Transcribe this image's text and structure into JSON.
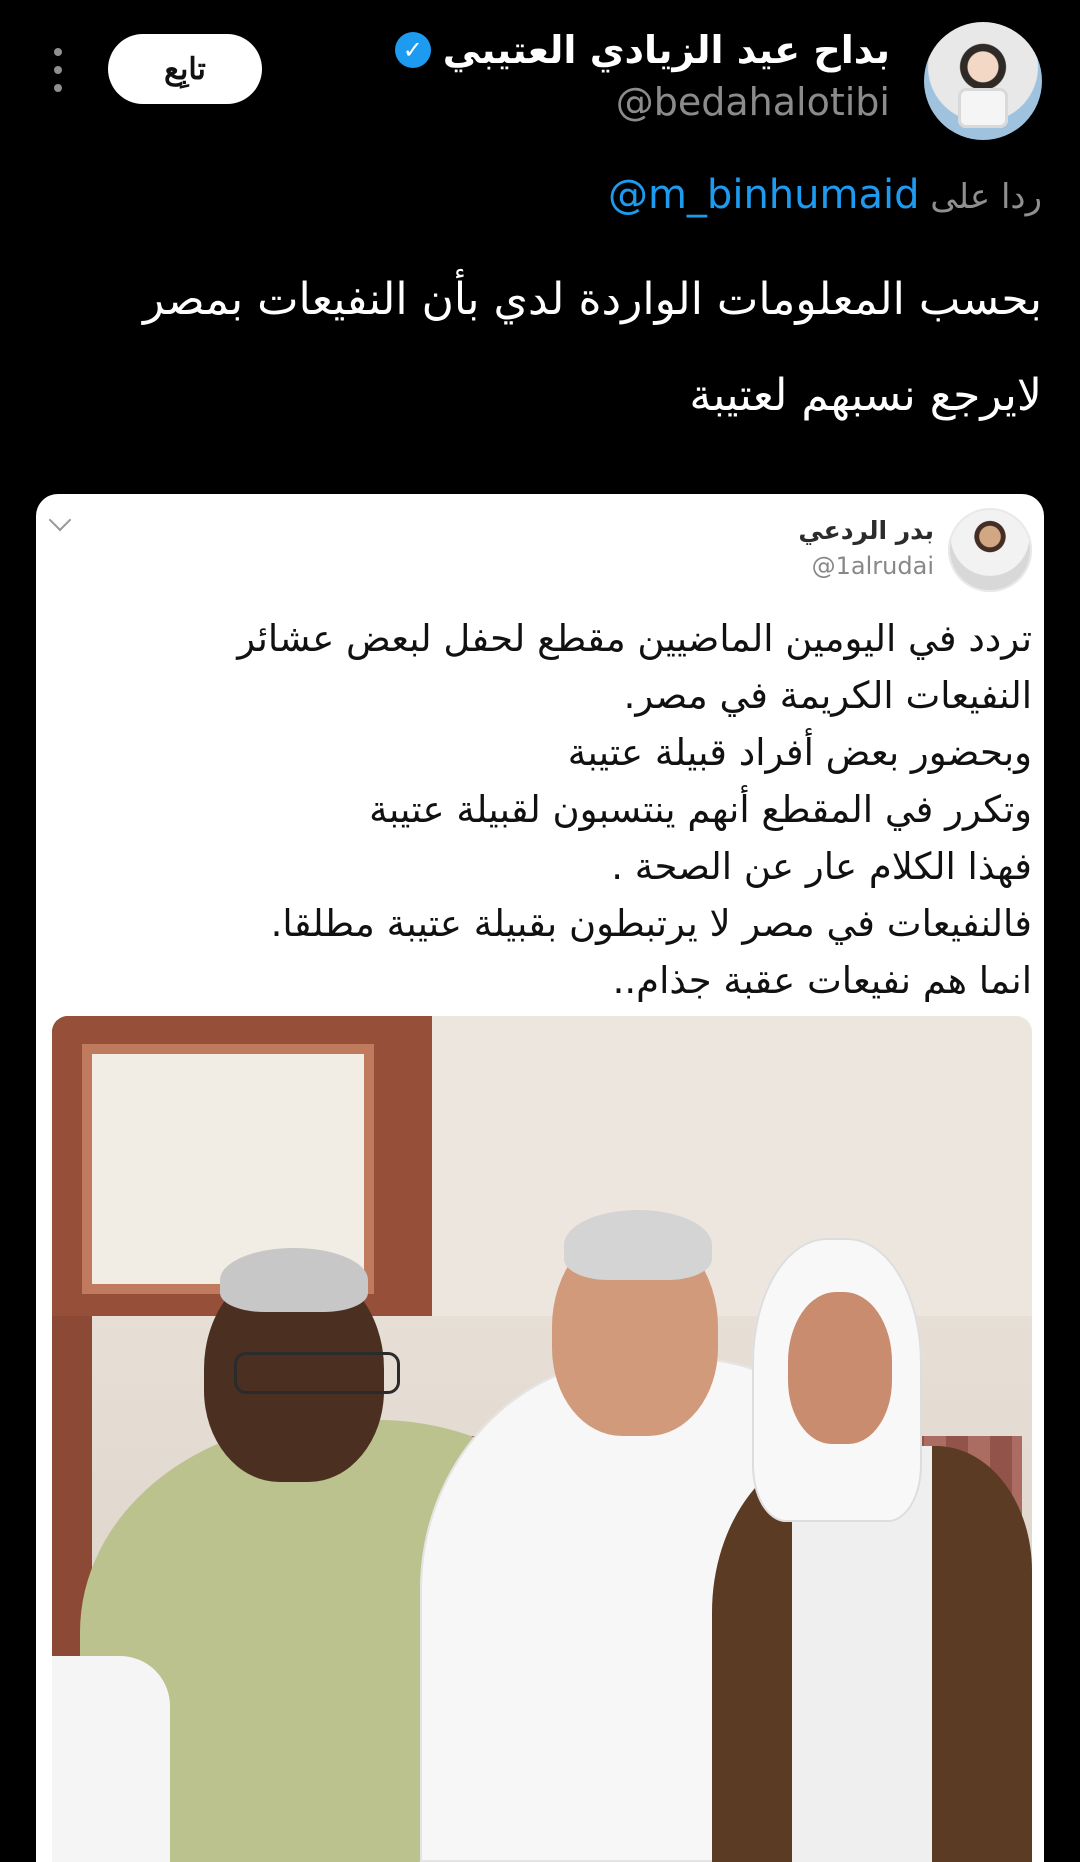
{
  "tweet": {
    "author_name": "بداح عيد الزيادي العتيبي",
    "author_handle": "@bedahalotibi",
    "follow_label": "تابِع",
    "reply_prefix": "ردا على",
    "reply_handle": "@m_binhumaid",
    "text_lines": [
      "بحسب المعلومات الواردة لدي بأن النفيعات بمصر",
      "لايرجع نسبهم لعتيبة"
    ]
  },
  "quoted_tweet": {
    "author_name": "بدر الردعي",
    "author_handle": "@1alrudai",
    "text_lines": [
      "تردد في اليومين الماضيين مقطع لحفل لبعض عشائر",
      "النفيعات الكريمة في مصر.",
      " وبحضور بعض أفراد قبيلة عتيبة",
      "وتكرر في المقطع أنهم ينتسبون لقبيلة عتيبة",
      "فهذا الكلام عار عن الصحة .",
      "فالنفيعات في مصر لا يرتبطون بقبيلة عتيبة مطلقا.",
      " انما هم نفيعات عقبة جذام.."
    ]
  },
  "icons": {
    "verified": "verified-icon",
    "more": "more-icon",
    "chevron": "chevron-down-icon"
  },
  "colors": {
    "background": "#000000",
    "link": "#1d9bf0",
    "muted": "#8b8b8b",
    "card": "#ffffff"
  }
}
